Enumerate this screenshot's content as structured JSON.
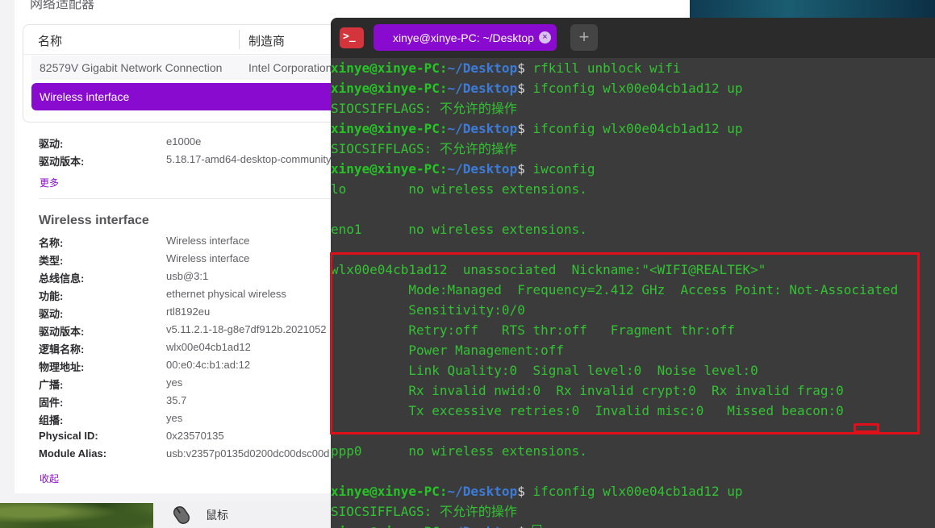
{
  "device_manager": {
    "section_heading": "网络适配器",
    "table": {
      "col_name": "名称",
      "col_vendor": "制造商",
      "rows": [
        {
          "name": "82579V Gigabit Network Connection",
          "vendor": "Intel Corporation"
        },
        {
          "name": "Wireless interface",
          "vendor": ""
        }
      ]
    },
    "summary": [
      {
        "label": "驱动:",
        "value": "e1000e"
      },
      {
        "label": "驱动版本:",
        "value": "5.18.17-amd64-desktop-community"
      }
    ],
    "more_link": "更多",
    "detail_title": "Wireless interface",
    "details": [
      {
        "label": "名称:",
        "value": "Wireless interface"
      },
      {
        "label": "类型:",
        "value": "Wireless interface"
      },
      {
        "label": "总线信息:",
        "value": "usb@3:1"
      },
      {
        "label": "功能:",
        "value": "ethernet physical wireless"
      },
      {
        "label": "驱动:",
        "value": "rtl8192eu"
      },
      {
        "label": "驱动版本:",
        "value": "v5.11.2.1-18-g8e7df912b.2021052"
      },
      {
        "label": "逻辑名称:",
        "value": "wlx00e04cb1ad12"
      },
      {
        "label": "物理地址:",
        "value": "00:e0:4c:b1:ad:12"
      },
      {
        "label": "广播:",
        "value": "yes"
      },
      {
        "label": "固件:",
        "value": "35.7"
      },
      {
        "label": "组播:",
        "value": "yes"
      },
      {
        "label": "Physical ID:",
        "value": "0x23570135"
      },
      {
        "label": "Module Alias:",
        "value": "usb:v2357p0135d0200dc00dsc00d"
      }
    ],
    "collapse_link": "收起",
    "sidebar_item": "鼠标",
    "sidebar_icon": "mouse-icon"
  },
  "terminal": {
    "tab_title": "xinye@xinye-PC: ~/Desktop",
    "new_tab_symbol": "+",
    "close_symbol": "×",
    "app_icon_text": ">_",
    "prompt_user": "xinye@xinye-PC",
    "prompt_sep": ":",
    "prompt_path": "~/Desktop",
    "prompt_dollar": "$",
    "lines": [
      {
        "kind": "cmd",
        "text": " rfkill unblock wifi"
      },
      {
        "kind": "cmd",
        "text": " ifconfig wlx00e04cb1ad12 up"
      },
      {
        "kind": "out",
        "text": "SIOCSIFFLAGS: 不允许的操作"
      },
      {
        "kind": "cmd",
        "text": " ifconfig wlx00e04cb1ad12 up"
      },
      {
        "kind": "out",
        "text": "SIOCSIFFLAGS: 不允许的操作"
      },
      {
        "kind": "cmd",
        "text": " iwconfig"
      },
      {
        "kind": "out",
        "text": "lo        no wireless extensions."
      },
      {
        "kind": "out",
        "text": ""
      },
      {
        "kind": "out",
        "text": "eno1      no wireless extensions."
      },
      {
        "kind": "out",
        "text": ""
      },
      {
        "kind": "out",
        "text": "wlx00e04cb1ad12  unassociated  Nickname:\"<WIFI@REALTEK>\""
      },
      {
        "kind": "out",
        "text": "          Mode:Managed  Frequency=2.412 GHz  Access Point: Not-Associated"
      },
      {
        "kind": "out",
        "text": "          Sensitivity:0/0"
      },
      {
        "kind": "out",
        "text": "          Retry:off   RTS thr:off   Fragment thr:off"
      },
      {
        "kind": "out",
        "text": "          Power Management:off"
      },
      {
        "kind": "out",
        "text": "          Link Quality:0  Signal level:0  Noise level:0"
      },
      {
        "kind": "out",
        "text": "          Rx invalid nwid:0  Rx invalid crypt:0  Rx invalid frag:0"
      },
      {
        "kind": "out",
        "text": "          Tx excessive retries:0  Invalid misc:0   Missed beacon:0"
      },
      {
        "kind": "out",
        "text": ""
      },
      {
        "kind": "out",
        "text": "ppp0      no wireless extensions."
      },
      {
        "kind": "out",
        "text": ""
      },
      {
        "kind": "cmd",
        "text": " ifconfig wlx00e04cb1ad12 up"
      },
      {
        "kind": "out",
        "text": "SIOCSIFFLAGS: 不允许的操作"
      },
      {
        "kind": "cmd_cursor",
        "text": " "
      }
    ]
  },
  "colors": {
    "accent": "#8a0bd0",
    "terminal_green": "#33c233",
    "terminal_path_blue": "#3c7bd8",
    "highlight_red": "#e0101a"
  }
}
